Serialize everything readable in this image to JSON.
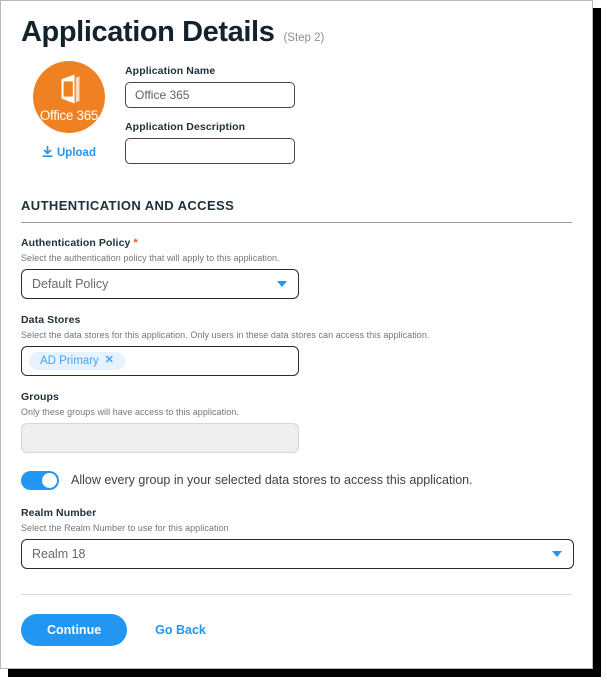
{
  "header": {
    "title": "Application Details",
    "step": "(Step 2)"
  },
  "identity": {
    "logo": {
      "name": "Office 365",
      "color": "#ef8122",
      "icon": "office-365-door-icon"
    },
    "upload_label": "Upload",
    "upload_icon": "download-arrow-icon",
    "fields": [
      {
        "label": "Application Name",
        "value": "Office 365",
        "placeholder": ""
      },
      {
        "label": "Application Description",
        "value": "",
        "placeholder": ""
      }
    ]
  },
  "section": {
    "title": "AUTHENTICATION AND ACCESS",
    "auth_policy": {
      "label": "Authentication Policy",
      "required_marker": "*",
      "help": "Select the authentication policy that will apply to this application.",
      "selected": "Default Policy",
      "caret_icon": "chevron-down-icon"
    },
    "data_stores": {
      "label": "Data Stores",
      "help": "Select the data stores for this application. Only users in these data stores can access this application.",
      "chips": [
        {
          "label": "AD Primary",
          "remove_icon": "close-icon",
          "remove_label": "✕"
        }
      ]
    },
    "groups": {
      "label": "Groups",
      "help": "Only these groups will have access to this application.",
      "value": "",
      "disabled": true
    },
    "allow_all_toggle": {
      "label": "Allow every group in your selected data stores to access this application.",
      "state": "on"
    },
    "realm": {
      "label": "Realm Number",
      "help": "Select the Realm Number to use for this application",
      "selected": "Realm 18",
      "caret_icon": "chevron-down-icon"
    }
  },
  "footer": {
    "continue_label": "Continue",
    "go_back_label": "Go Back"
  },
  "colors": {
    "accent": "#2196f3",
    "logo_orange": "#ef8122",
    "required": "#f4511e",
    "chip_bg": "#e6f2fd",
    "chip_text": "#4ba3ef"
  }
}
